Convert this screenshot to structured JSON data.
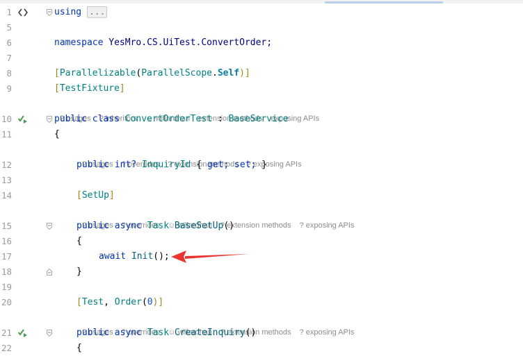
{
  "editor": {
    "lines": [
      {
        "num": "1",
        "tokens": [
          "using",
          "..."
        ]
      },
      {
        "num": "5",
        "tokens": []
      },
      {
        "num": "6",
        "tokens": [
          "namespace",
          "YesMro.CS.UiTest.ConvertOrder;"
        ]
      },
      {
        "num": "7",
        "tokens": []
      },
      {
        "num": "8",
        "tokens": [
          "[",
          "Parallelizable",
          "(",
          "ParallelScope",
          ".",
          "Self",
          ")]"
        ]
      },
      {
        "num": "9",
        "tokens": [
          "[",
          "TestFixture",
          "]"
        ]
      },
      {
        "num": "10",
        "tokens": [
          "public class",
          "ConvertOrderTest",
          ":",
          "BaseService"
        ]
      },
      {
        "num": "11",
        "tokens": [
          "{"
        ]
      },
      {
        "num": "12",
        "tokens": [
          "public",
          "int?",
          "InquiryId",
          "{",
          "get;",
          "set;",
          "}"
        ]
      },
      {
        "num": "13",
        "tokens": []
      },
      {
        "num": "14",
        "tokens": [
          "[",
          "SetUp",
          "]"
        ]
      },
      {
        "num": "15",
        "tokens": [
          "public async",
          "Task",
          "BaseSetUp",
          "()"
        ]
      },
      {
        "num": "16",
        "tokens": [
          "{"
        ]
      },
      {
        "num": "17",
        "tokens": [
          "await",
          "Init",
          "();"
        ]
      },
      {
        "num": "18",
        "tokens": [
          "}"
        ]
      },
      {
        "num": "19",
        "tokens": []
      },
      {
        "num": "20",
        "tokens": [
          "[",
          "Test",
          ",",
          "Order",
          "(",
          "0",
          ")]"
        ]
      },
      {
        "num": "21",
        "tokens": [
          "public async",
          "Task",
          "CreateInquiry",
          "()"
        ]
      },
      {
        "num": "22",
        "tokens": [
          "{"
        ]
      }
    ],
    "hints": {
      "class_hint": [
        "? usages",
        "? inheritors",
        "willardhan",
        "extension methods",
        "exposing APIs"
      ],
      "prop_hint": [
        "? usages",
        "? overrides",
        "? extension methods",
        "? exposing APIs"
      ],
      "setup_hint": [
        "? usages",
        "? overrides",
        "willardhan",
        "? extension methods",
        "? exposing APIs"
      ],
      "test_hint": [
        "? usages",
        "? overrides",
        "willardhan",
        "? extension methods",
        "? exposing APIs"
      ]
    }
  },
  "colors": {
    "keyword": "#0033b3",
    "type": "#008080",
    "annotation_arrow": "#e8352f",
    "run_icon": "#499c54"
  },
  "icons": [
    "code-braces-icon",
    "run-test-icon",
    "fold-icon",
    "user-icon",
    "red-arrow-annotation"
  ]
}
